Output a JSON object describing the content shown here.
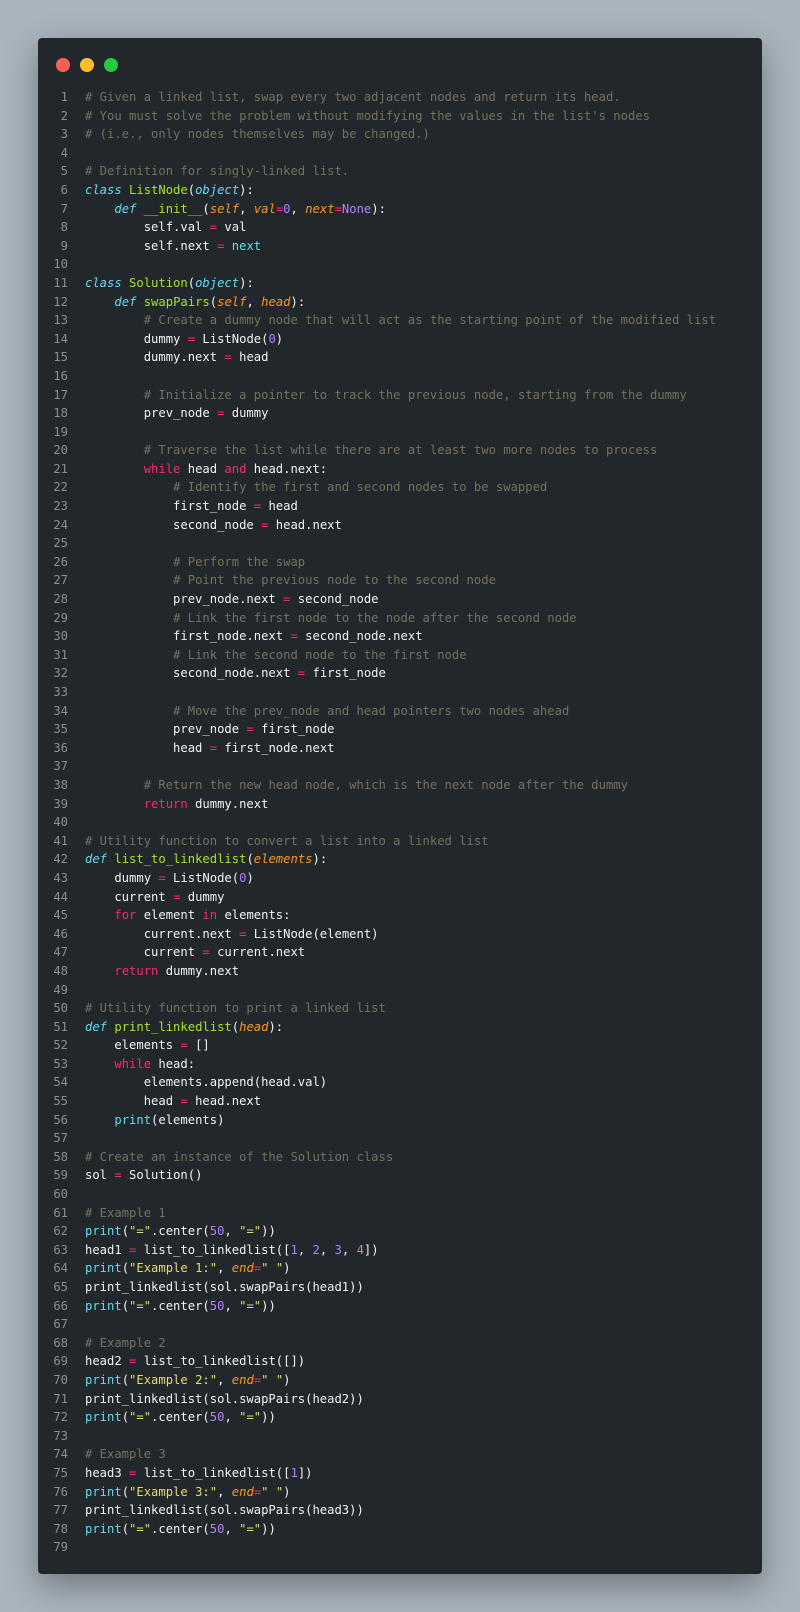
{
  "window": {
    "controls": [
      {
        "name": "close",
        "color": "#ff5f56"
      },
      {
        "name": "minimize",
        "color": "#ffbd2e"
      },
      {
        "name": "maximize",
        "color": "#27c93f"
      }
    ]
  },
  "code": {
    "lines": [
      [
        [
          "cmt",
          "# Given a linked list, swap every two adjacent nodes and return its head."
        ]
      ],
      [
        [
          "cmt",
          "# You must solve the problem without modifying the values in the list's nodes"
        ]
      ],
      [
        [
          "cmt",
          "# (i.e., only nodes themselves may be changed.)"
        ]
      ],
      [],
      [
        [
          "cmt",
          "# Definition for singly-linked list."
        ]
      ],
      [
        [
          "kwi",
          "class"
        ],
        [
          "txt",
          " "
        ],
        [
          "cls",
          "ListNode"
        ],
        [
          "txt",
          "("
        ],
        [
          "kwi",
          "object"
        ],
        [
          "txt",
          "):"
        ]
      ],
      [
        [
          "txt",
          "    "
        ],
        [
          "kwi",
          "def"
        ],
        [
          "txt",
          " "
        ],
        [
          "fn",
          "__init__"
        ],
        [
          "txt",
          "("
        ],
        [
          "prm",
          "self"
        ],
        [
          "txt",
          ", "
        ],
        [
          "prm",
          "val"
        ],
        [
          "op",
          "="
        ],
        [
          "num",
          "0"
        ],
        [
          "txt",
          ", "
        ],
        [
          "prm",
          "next"
        ],
        [
          "op",
          "="
        ],
        [
          "num",
          "None"
        ],
        [
          "txt",
          "):"
        ]
      ],
      [
        [
          "txt",
          "        self.val "
        ],
        [
          "op",
          "="
        ],
        [
          "txt",
          " val"
        ]
      ],
      [
        [
          "txt",
          "        self.next "
        ],
        [
          "op",
          "="
        ],
        [
          "txt",
          " "
        ],
        [
          "blt",
          "next"
        ]
      ],
      [],
      [
        [
          "kwi",
          "class"
        ],
        [
          "txt",
          " "
        ],
        [
          "cls",
          "Solution"
        ],
        [
          "txt",
          "("
        ],
        [
          "kwi",
          "object"
        ],
        [
          "txt",
          "):"
        ]
      ],
      [
        [
          "txt",
          "    "
        ],
        [
          "kwi",
          "def"
        ],
        [
          "txt",
          " "
        ],
        [
          "fn",
          "swapPairs"
        ],
        [
          "txt",
          "("
        ],
        [
          "prm",
          "self"
        ],
        [
          "txt",
          ", "
        ],
        [
          "prm",
          "head"
        ],
        [
          "txt",
          "):"
        ]
      ],
      [
        [
          "txt",
          "        "
        ],
        [
          "cmt",
          "# Create a dummy node that will act as the starting point of the modified list"
        ]
      ],
      [
        [
          "txt",
          "        dummy "
        ],
        [
          "op",
          "="
        ],
        [
          "txt",
          " ListNode("
        ],
        [
          "num",
          "0"
        ],
        [
          "txt",
          ")"
        ]
      ],
      [
        [
          "txt",
          "        dummy.next "
        ],
        [
          "op",
          "="
        ],
        [
          "txt",
          " head"
        ]
      ],
      [],
      [
        [
          "txt",
          "        "
        ],
        [
          "cmt",
          "# Initialize a pointer to track the previous node, starting from the dummy"
        ]
      ],
      [
        [
          "txt",
          "        prev_node "
        ],
        [
          "op",
          "="
        ],
        [
          "txt",
          " dummy"
        ]
      ],
      [],
      [
        [
          "txt",
          "        "
        ],
        [
          "cmt",
          "# Traverse the list while there are at least two more nodes to process"
        ]
      ],
      [
        [
          "txt",
          "        "
        ],
        [
          "kw",
          "while"
        ],
        [
          "txt",
          " head "
        ],
        [
          "kw",
          "and"
        ],
        [
          "txt",
          " head.next:"
        ]
      ],
      [
        [
          "txt",
          "            "
        ],
        [
          "cmt",
          "# Identify the first and second nodes to be swapped"
        ]
      ],
      [
        [
          "txt",
          "            first_node "
        ],
        [
          "op",
          "="
        ],
        [
          "txt",
          " head"
        ]
      ],
      [
        [
          "txt",
          "            second_node "
        ],
        [
          "op",
          "="
        ],
        [
          "txt",
          " head.next"
        ]
      ],
      [],
      [
        [
          "txt",
          "            "
        ],
        [
          "cmt",
          "# Perform the swap"
        ]
      ],
      [
        [
          "txt",
          "            "
        ],
        [
          "cmt",
          "# Point the previous node to the second node"
        ]
      ],
      [
        [
          "txt",
          "            prev_node.next "
        ],
        [
          "op",
          "="
        ],
        [
          "txt",
          " second_node"
        ]
      ],
      [
        [
          "txt",
          "            "
        ],
        [
          "cmt",
          "# Link the first node to the node after the second node"
        ]
      ],
      [
        [
          "txt",
          "            first_node.next "
        ],
        [
          "op",
          "="
        ],
        [
          "txt",
          " second_node.next"
        ]
      ],
      [
        [
          "txt",
          "            "
        ],
        [
          "cmt",
          "# Link the second node to the first node"
        ]
      ],
      [
        [
          "txt",
          "            second_node.next "
        ],
        [
          "op",
          "="
        ],
        [
          "txt",
          " first_node"
        ]
      ],
      [],
      [
        [
          "txt",
          "            "
        ],
        [
          "cmt",
          "# Move the prev_node and head pointers two nodes ahead"
        ]
      ],
      [
        [
          "txt",
          "            prev_node "
        ],
        [
          "op",
          "="
        ],
        [
          "txt",
          " first_node"
        ]
      ],
      [
        [
          "txt",
          "            head "
        ],
        [
          "op",
          "="
        ],
        [
          "txt",
          " first_node.next"
        ]
      ],
      [],
      [
        [
          "txt",
          "        "
        ],
        [
          "cmt",
          "# Return the new head node, which is the next node after the dummy"
        ]
      ],
      [
        [
          "txt",
          "        "
        ],
        [
          "kw",
          "return"
        ],
        [
          "txt",
          " dummy.next"
        ]
      ],
      [],
      [
        [
          "cmt",
          "# Utility function to convert a list into a linked list"
        ]
      ],
      [
        [
          "kwi",
          "def"
        ],
        [
          "txt",
          " "
        ],
        [
          "fn",
          "list_to_linkedlist"
        ],
        [
          "txt",
          "("
        ],
        [
          "prm",
          "elements"
        ],
        [
          "txt",
          "):"
        ]
      ],
      [
        [
          "txt",
          "    dummy "
        ],
        [
          "op",
          "="
        ],
        [
          "txt",
          " ListNode("
        ],
        [
          "num",
          "0"
        ],
        [
          "txt",
          ")"
        ]
      ],
      [
        [
          "txt",
          "    current "
        ],
        [
          "op",
          "="
        ],
        [
          "txt",
          " dummy"
        ]
      ],
      [
        [
          "txt",
          "    "
        ],
        [
          "kw",
          "for"
        ],
        [
          "txt",
          " element "
        ],
        [
          "kw",
          "in"
        ],
        [
          "txt",
          " elements:"
        ]
      ],
      [
        [
          "txt",
          "        current.next "
        ],
        [
          "op",
          "="
        ],
        [
          "txt",
          " ListNode(element)"
        ]
      ],
      [
        [
          "txt",
          "        current "
        ],
        [
          "op",
          "="
        ],
        [
          "txt",
          " current.next"
        ]
      ],
      [
        [
          "txt",
          "    "
        ],
        [
          "kw",
          "return"
        ],
        [
          "txt",
          " dummy.next"
        ]
      ],
      [],
      [
        [
          "cmt",
          "# Utility function to print a linked list"
        ]
      ],
      [
        [
          "kwi",
          "def"
        ],
        [
          "txt",
          " "
        ],
        [
          "fn",
          "print_linkedlist"
        ],
        [
          "txt",
          "("
        ],
        [
          "prm",
          "head"
        ],
        [
          "txt",
          "):"
        ]
      ],
      [
        [
          "txt",
          "    elements "
        ],
        [
          "op",
          "="
        ],
        [
          "txt",
          " []"
        ]
      ],
      [
        [
          "txt",
          "    "
        ],
        [
          "kw",
          "while"
        ],
        [
          "txt",
          " head:"
        ]
      ],
      [
        [
          "txt",
          "        elements.append(head.val)"
        ]
      ],
      [
        [
          "txt",
          "        head "
        ],
        [
          "op",
          "="
        ],
        [
          "txt",
          " head.next"
        ]
      ],
      [
        [
          "txt",
          "    "
        ],
        [
          "blt",
          "print"
        ],
        [
          "txt",
          "(elements)"
        ]
      ],
      [],
      [
        [
          "cmt",
          "# Create an instance of the Solution class"
        ]
      ],
      [
        [
          "txt",
          "sol "
        ],
        [
          "op",
          "="
        ],
        [
          "txt",
          " Solution()"
        ]
      ],
      [],
      [
        [
          "cmt",
          "# Example 1"
        ]
      ],
      [
        [
          "blt",
          "print"
        ],
        [
          "txt",
          "("
        ],
        [
          "str",
          "\"=\""
        ],
        [
          "txt",
          ".center("
        ],
        [
          "num",
          "50"
        ],
        [
          "txt",
          ", "
        ],
        [
          "str",
          "\"=\""
        ],
        [
          "txt",
          "))"
        ]
      ],
      [
        [
          "txt",
          "head1 "
        ],
        [
          "op",
          "="
        ],
        [
          "txt",
          " list_to_linkedlist(["
        ],
        [
          "num",
          "1"
        ],
        [
          "txt",
          ", "
        ],
        [
          "num",
          "2"
        ],
        [
          "txt",
          ", "
        ],
        [
          "num",
          "3"
        ],
        [
          "txt",
          ", "
        ],
        [
          "num",
          "4"
        ],
        [
          "txt",
          "])"
        ]
      ],
      [
        [
          "blt",
          "print"
        ],
        [
          "txt",
          "("
        ],
        [
          "str",
          "\"Example 1:\""
        ],
        [
          "txt",
          ", "
        ],
        [
          "prm",
          "end"
        ],
        [
          "op",
          "="
        ],
        [
          "str",
          "\" \""
        ],
        [
          "txt",
          ")"
        ]
      ],
      [
        [
          "txt",
          "print_linkedlist(sol.swapPairs(head1))"
        ]
      ],
      [
        [
          "blt",
          "print"
        ],
        [
          "txt",
          "("
        ],
        [
          "str",
          "\"=\""
        ],
        [
          "txt",
          ".center("
        ],
        [
          "num",
          "50"
        ],
        [
          "txt",
          ", "
        ],
        [
          "str",
          "\"=\""
        ],
        [
          "txt",
          "))"
        ]
      ],
      [],
      [
        [
          "cmt",
          "# Example 2"
        ]
      ],
      [
        [
          "txt",
          "head2 "
        ],
        [
          "op",
          "="
        ],
        [
          "txt",
          " list_to_linkedlist([])"
        ]
      ],
      [
        [
          "blt",
          "print"
        ],
        [
          "txt",
          "("
        ],
        [
          "str",
          "\"Example 2:\""
        ],
        [
          "txt",
          ", "
        ],
        [
          "prm",
          "end"
        ],
        [
          "op",
          "="
        ],
        [
          "str",
          "\" \""
        ],
        [
          "txt",
          ")"
        ]
      ],
      [
        [
          "txt",
          "print_linkedlist(sol.swapPairs(head2))"
        ]
      ],
      [
        [
          "blt",
          "print"
        ],
        [
          "txt",
          "("
        ],
        [
          "str",
          "\"=\""
        ],
        [
          "txt",
          ".center("
        ],
        [
          "num",
          "50"
        ],
        [
          "txt",
          ", "
        ],
        [
          "str",
          "\"=\""
        ],
        [
          "txt",
          "))"
        ]
      ],
      [],
      [
        [
          "cmt",
          "# Example 3"
        ]
      ],
      [
        [
          "txt",
          "head3 "
        ],
        [
          "op",
          "="
        ],
        [
          "txt",
          " list_to_linkedlist(["
        ],
        [
          "num",
          "1"
        ],
        [
          "txt",
          "])"
        ]
      ],
      [
        [
          "blt",
          "print"
        ],
        [
          "txt",
          "("
        ],
        [
          "str",
          "\"Example 3:\""
        ],
        [
          "txt",
          ", "
        ],
        [
          "prm",
          "end"
        ],
        [
          "op",
          "="
        ],
        [
          "str",
          "\" \""
        ],
        [
          "txt",
          ")"
        ]
      ],
      [
        [
          "txt",
          "print_linkedlist(sol.swapPairs(head3))"
        ]
      ],
      [
        [
          "blt",
          "print"
        ],
        [
          "txt",
          "("
        ],
        [
          "str",
          "\"=\""
        ],
        [
          "txt",
          ".center("
        ],
        [
          "num",
          "50"
        ],
        [
          "txt",
          ", "
        ],
        [
          "str",
          "\"=\""
        ],
        [
          "txt",
          "))"
        ]
      ],
      []
    ]
  }
}
